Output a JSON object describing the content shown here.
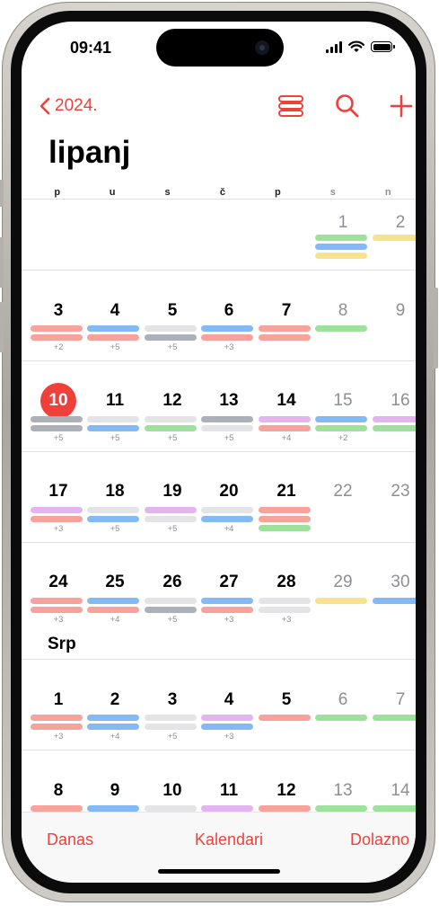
{
  "status_bar": {
    "time": "09:41"
  },
  "header": {
    "back_label": "2024.",
    "month_title": "lipanj"
  },
  "weekdays": [
    "p",
    "u",
    "s",
    "č",
    "p",
    "s",
    "n"
  ],
  "colors": {
    "accent": "#f0403a",
    "red": "#f7a29b",
    "blue": "#83baf5",
    "gray": "#acb0b8",
    "lightgray": "#e4e4e6",
    "green": "#9ee19c",
    "yellow": "#f8e38a",
    "purple": "#e3b5ee"
  },
  "calendar": {
    "second_month_label": "Srp",
    "weeks": [
      {
        "days": [
          {
            "n": "",
            "bars": []
          },
          {
            "n": "",
            "bars": []
          },
          {
            "n": "",
            "bars": []
          },
          {
            "n": "",
            "bars": []
          },
          {
            "n": "",
            "bars": []
          },
          {
            "n": "1",
            "bars": [
              "green",
              "blue",
              "yellow"
            ]
          },
          {
            "n": "2",
            "bars": [
              "yellow"
            ]
          }
        ]
      },
      {
        "days": [
          {
            "n": "3",
            "bars": [
              "red",
              "red"
            ],
            "more": "+2"
          },
          {
            "n": "4",
            "bars": [
              "blue",
              "red"
            ],
            "more": "+5"
          },
          {
            "n": "5",
            "bars": [
              "lightgray",
              "gray"
            ],
            "more": "+5"
          },
          {
            "n": "6",
            "bars": [
              "blue",
              "red"
            ],
            "more": "+3"
          },
          {
            "n": "7",
            "bars": [
              "red",
              "red"
            ]
          },
          {
            "n": "8",
            "bars": [
              "green"
            ]
          },
          {
            "n": "9",
            "bars": []
          }
        ]
      },
      {
        "days": [
          {
            "n": "10",
            "today": true,
            "bars": [
              "gray",
              "gray"
            ],
            "more": "+5"
          },
          {
            "n": "11",
            "bars": [
              "lightgray",
              "blue"
            ],
            "more": "+5"
          },
          {
            "n": "12",
            "bars": [
              "lightgray",
              "green"
            ],
            "more": "+5"
          },
          {
            "n": "13",
            "bars": [
              "gray",
              "lightgray"
            ],
            "more": "+5"
          },
          {
            "n": "14",
            "bars": [
              "purple",
              "red"
            ],
            "more": "+4"
          },
          {
            "n": "15",
            "bars": [
              "blue",
              "green"
            ],
            "more": "+2"
          },
          {
            "n": "16",
            "bars": [
              "purple",
              "green"
            ]
          }
        ]
      },
      {
        "days": [
          {
            "n": "17",
            "bars": [
              "purple",
              "red"
            ],
            "more": "+3"
          },
          {
            "n": "18",
            "bars": [
              "lightgray",
              "blue"
            ],
            "more": "+5"
          },
          {
            "n": "19",
            "bars": [
              "purple",
              "lightgray"
            ],
            "more": "+5"
          },
          {
            "n": "20",
            "bars": [
              "lightgray",
              "blue"
            ],
            "more": "+4"
          },
          {
            "n": "21",
            "bars": [
              "red",
              "red",
              "green"
            ]
          },
          {
            "n": "22",
            "bars": []
          },
          {
            "n": "23",
            "bars": []
          }
        ]
      },
      {
        "days": [
          {
            "n": "24",
            "bars": [
              "red",
              "red"
            ],
            "more": "+3"
          },
          {
            "n": "25",
            "bars": [
              "blue",
              "red"
            ],
            "more": "+4"
          },
          {
            "n": "26",
            "bars": [
              "lightgray",
              "gray"
            ],
            "more": "+5"
          },
          {
            "n": "27",
            "bars": [
              "blue",
              "red"
            ],
            "more": "+3"
          },
          {
            "n": "28",
            "bars": [
              "lightgray",
              "lightgray"
            ],
            "more": "+3"
          },
          {
            "n": "29",
            "bars": [
              "yellow"
            ]
          },
          {
            "n": "30",
            "bars": [
              "blue"
            ]
          }
        ]
      },
      {
        "days": [
          {
            "n": "1",
            "bars": [
              "red",
              "red"
            ],
            "more": "+3"
          },
          {
            "n": "2",
            "bars": [
              "blue",
              "blue"
            ],
            "more": "+4"
          },
          {
            "n": "3",
            "bars": [
              "lightgray",
              "lightgray"
            ],
            "more": "+5"
          },
          {
            "n": "4",
            "bars": [
              "purple",
              "blue"
            ],
            "more": "+3"
          },
          {
            "n": "5",
            "bars": [
              "red"
            ]
          },
          {
            "n": "6",
            "bars": [
              "green"
            ]
          },
          {
            "n": "7",
            "bars": [
              "green"
            ]
          }
        ]
      },
      {
        "days": [
          {
            "n": "8",
            "bars": [
              "red"
            ]
          },
          {
            "n": "9",
            "bars": [
              "blue"
            ]
          },
          {
            "n": "10",
            "bars": [
              "lightgray"
            ]
          },
          {
            "n": "11",
            "bars": [
              "purple"
            ]
          },
          {
            "n": "12",
            "bars": [
              "red"
            ]
          },
          {
            "n": "13",
            "bars": [
              "green"
            ]
          },
          {
            "n": "14",
            "bars": [
              "green"
            ]
          }
        ]
      }
    ]
  },
  "tabbar": {
    "today": "Danas",
    "calendars": "Kalendari",
    "inbox": "Dolazno"
  }
}
